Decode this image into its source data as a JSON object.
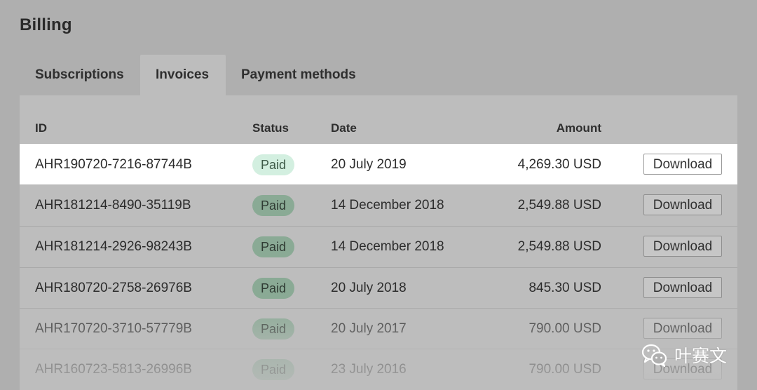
{
  "page": {
    "title": "Billing"
  },
  "tabs": [
    {
      "label": "Subscriptions",
      "active": false
    },
    {
      "label": "Invoices",
      "active": true
    },
    {
      "label": "Payment methods",
      "active": false
    }
  ],
  "table": {
    "columns": {
      "id": "ID",
      "status": "Status",
      "date": "Date",
      "amount": "Amount"
    },
    "rows": [
      {
        "id": "AHR190720-7216-87744B",
        "status": "Paid",
        "date": "20 July 2019",
        "amount": "4,269.30 USD",
        "action": "Download",
        "highlighted": true
      },
      {
        "id": "AHR181214-8490-35119B",
        "status": "Paid",
        "date": "14 December 2018",
        "amount": "2,549.88 USD",
        "action": "Download"
      },
      {
        "id": "AHR181214-2926-98243B",
        "status": "Paid",
        "date": "14 December 2018",
        "amount": "2,549.88 USD",
        "action": "Download"
      },
      {
        "id": "AHR180720-2758-26976B",
        "status": "Paid",
        "date": "20 July 2018",
        "amount": "845.30 USD",
        "action": "Download"
      },
      {
        "id": "AHR170720-3710-57779B",
        "status": "Paid",
        "date": "20 July 2017",
        "amount": "790.00 USD",
        "action": "Download"
      },
      {
        "id": "AHR160723-5813-26996B",
        "status": "Paid",
        "date": "23 July 2016",
        "amount": "790.00 USD",
        "action": "Download"
      }
    ]
  },
  "watermark": {
    "text": "叶赛文",
    "icon": "wechat-icon"
  },
  "colors": {
    "background": "#afafaf",
    "panel": "#bdbdbd",
    "highlight_row": "#ffffff",
    "paid_badge": "#8aaa95",
    "paid_badge_highlight": "#d3efe0"
  }
}
